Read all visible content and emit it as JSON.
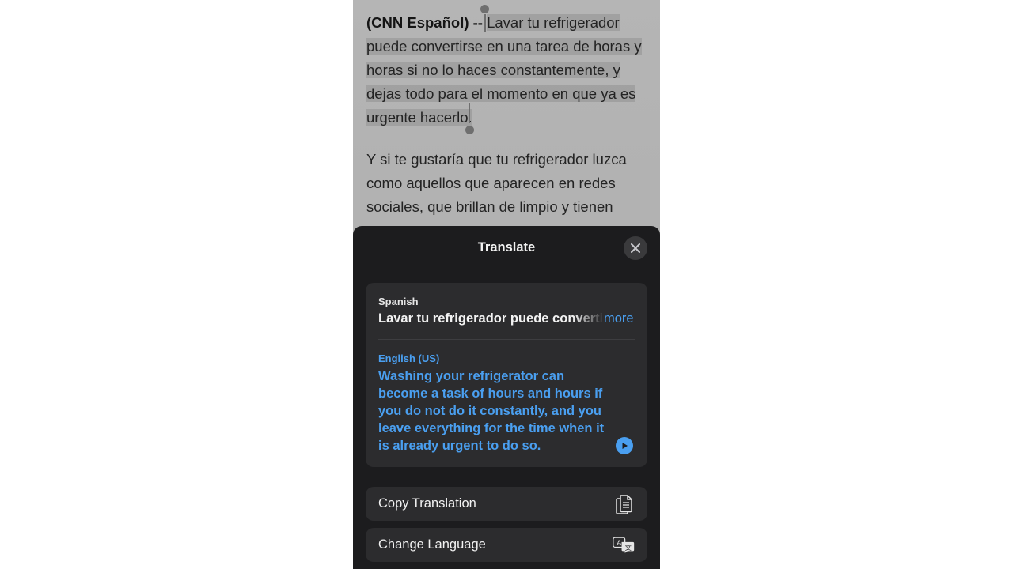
{
  "article": {
    "lead": "(CNN Español) --",
    "para1_selected": "Lavar tu refrigerador puede convertirse en una tarea de horas y horas si no lo haces constantemente, y dejas todo para el momento en que ya es urgente hacerlo.",
    "para2": "Y si te gustaría que tu refrigerador luzca como aquellos que aparecen en redes sociales, que brillan de limpio y tienen"
  },
  "sheet": {
    "title": "Translate",
    "close_icon": "close-icon"
  },
  "translation": {
    "source_language": "Spanish",
    "source_text": "Lavar tu refrigerador puede convertirse",
    "more_label": "more",
    "target_language": "English (US)",
    "target_text": "Washing your refrigerator can become a task of hours and hours if you do not do it constantly, and you leave everything for the time when it is already urgent to do so.",
    "play_icon": "play-icon"
  },
  "actions": [
    {
      "label": "Copy Translation",
      "icon": "copy-icon"
    },
    {
      "label": "Change Language",
      "icon": "translate-icon"
    }
  ],
  "colors": {
    "accent": "#4a9ff0",
    "sheet_bg": "#1c1c1e",
    "card_bg": "#2c2c2e"
  }
}
